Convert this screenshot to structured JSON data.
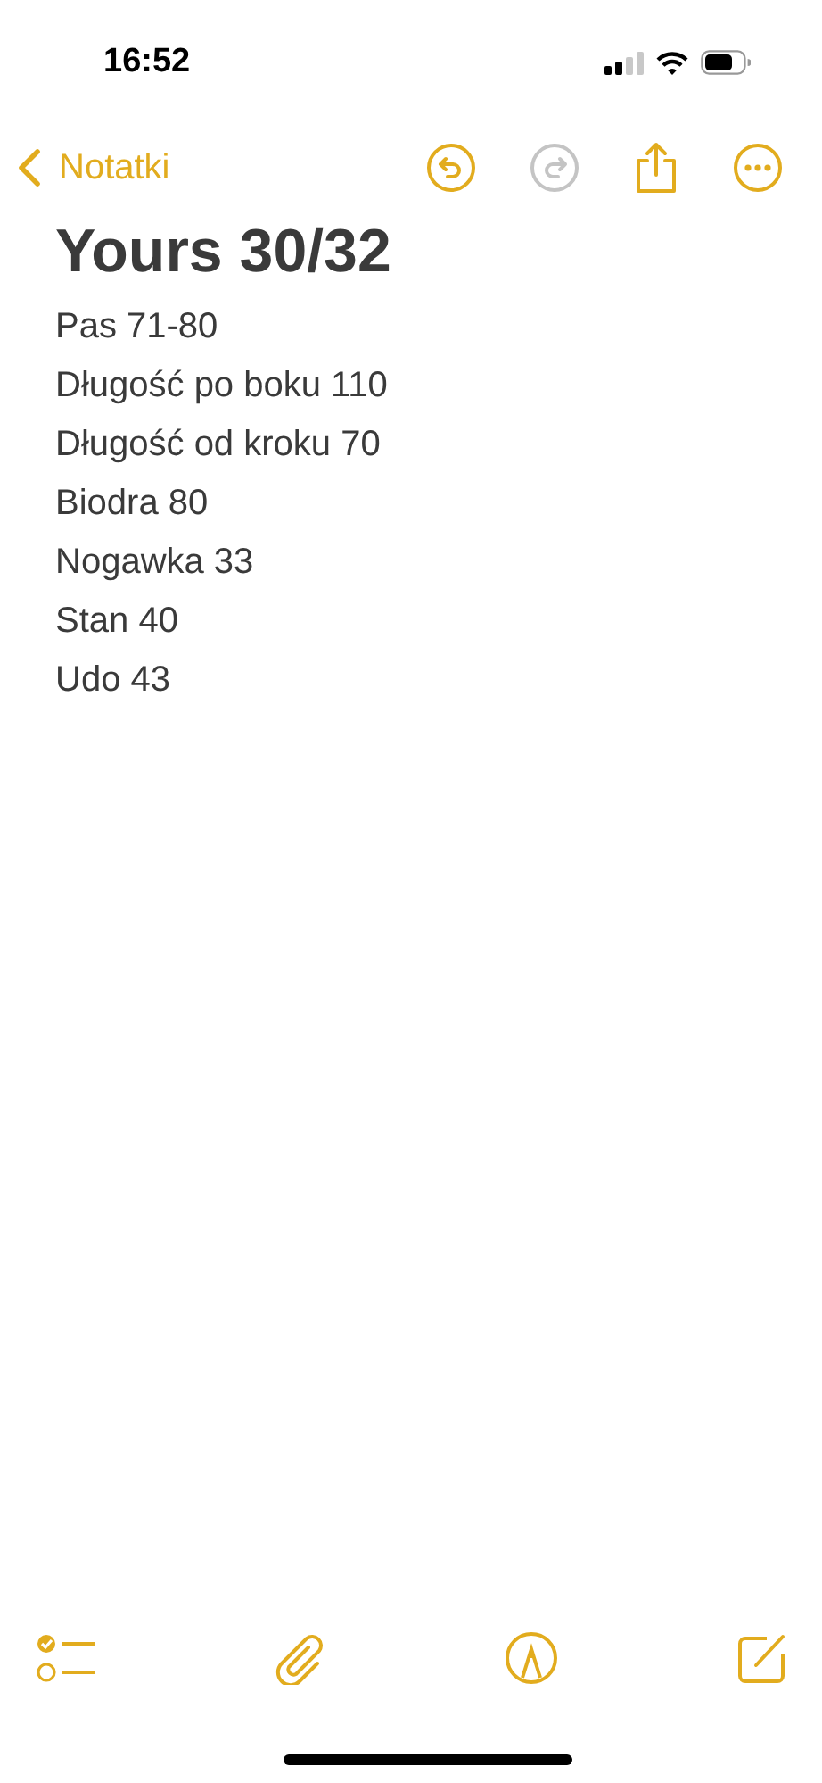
{
  "status_bar": {
    "time": "16:52"
  },
  "nav": {
    "back_label": "Notatki",
    "undo": {
      "disabled": false
    },
    "redo": {
      "disabled": true
    }
  },
  "note": {
    "title": "Yours 30/32",
    "lines": [
      "Pas 71-80",
      "Długość po boku 110",
      "Długość od kroku 70",
      "Biodra 80",
      "Nogawka 33",
      "Stan 40",
      "Udo 43"
    ]
  }
}
